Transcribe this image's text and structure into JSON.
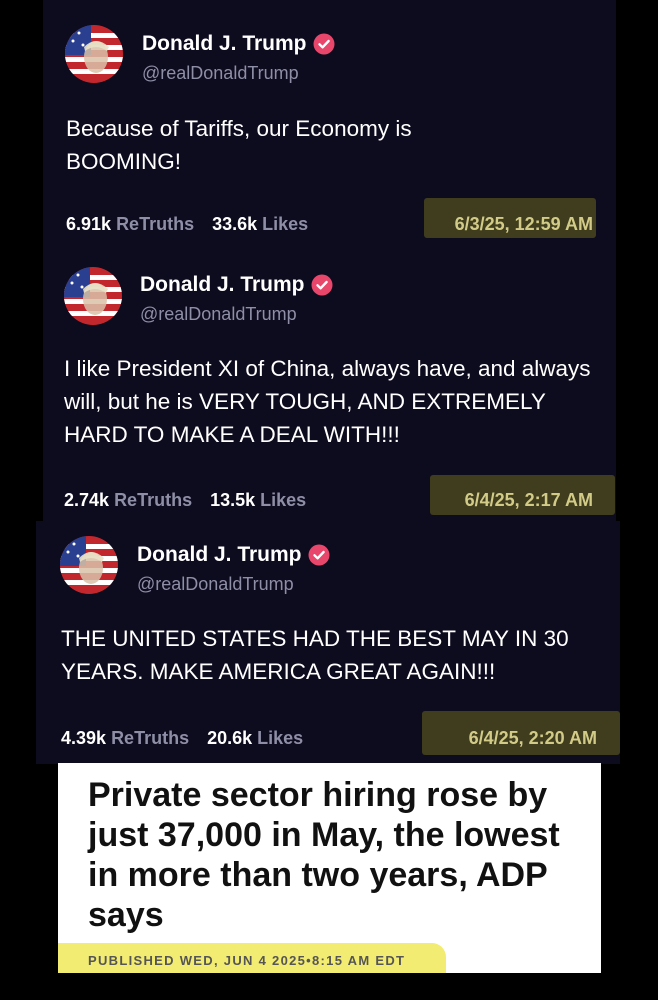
{
  "posts": [
    {
      "name": "Donald J. Trump",
      "handle": "@realDonaldTrump",
      "text": "Because of Tariffs, our Economy is BOOMING!",
      "retruths_count": "6.91k",
      "retruths_label": "ReTruths",
      "likes_count": "33.6k",
      "likes_label": "Likes",
      "timestamp": "6/3/25, 12:59 AM"
    },
    {
      "name": "Donald J. Trump",
      "handle": "@realDonaldTrump",
      "text": "I like President XI of China, always have, and always will, but he is VERY TOUGH, AND EXTREMELY HARD TO MAKE A DEAL WITH!!!",
      "retruths_count": "2.74k",
      "retruths_label": "ReTruths",
      "likes_count": "13.5k",
      "likes_label": "Likes",
      "timestamp": "6/4/25, 2:17 AM"
    },
    {
      "name": "Donald J. Trump",
      "handle": "@realDonaldTrump",
      "text": "THE UNITED STATES HAD THE BEST MAY IN 30 YEARS. MAKE AMERICA GREAT AGAIN!!!",
      "retruths_count": "4.39k",
      "retruths_label": "ReTruths",
      "likes_count": "20.6k",
      "likes_label": "Likes",
      "timestamp": "6/4/25, 2:20 AM"
    }
  ],
  "article": {
    "headline": "Private sector hiring rose by just 37,000 in May, the lowest in more than two years, ADP says",
    "published": "PUBLISHED WED, JUN 4 2025•8:15 AM EDT"
  },
  "colors": {
    "post_background": "#0d0b1e",
    "secondary_text": "#8e8ea6",
    "verified_badge": "#e8476b",
    "timestamp_highlight": "#3f3d1e",
    "timestamp_text": "#d2cb88",
    "article_highlight": "#f3ec72"
  },
  "icons": {
    "avatar": "avatar-image",
    "verified": "verified-badge-icon"
  }
}
